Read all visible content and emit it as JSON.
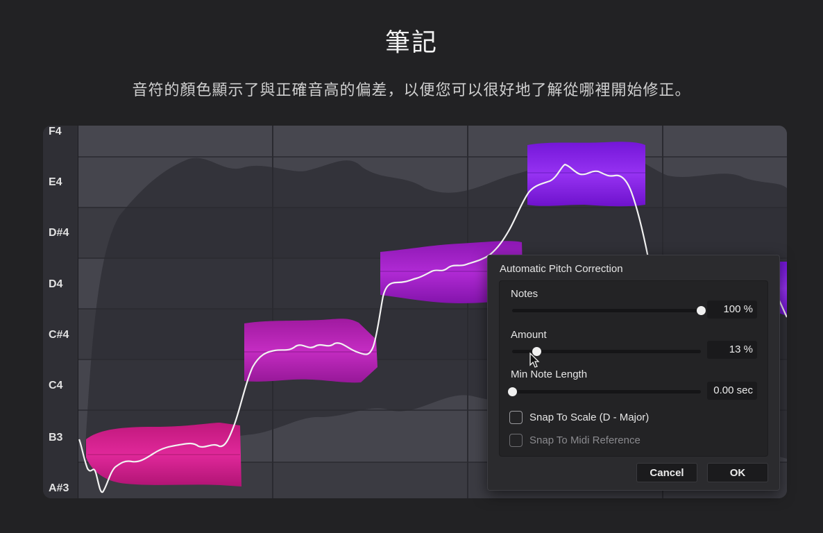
{
  "header": {
    "title": "筆記",
    "subtitle": "音符的顏色顯示了與正確音高的偏差，以便您可以很好地了解從哪裡開始修正。"
  },
  "piano_roll": {
    "keys": [
      "F4",
      "E4",
      "D#4",
      "D4",
      "C#4",
      "C4",
      "B3",
      "A#3"
    ],
    "note_colors": {
      "b3_note": "#d61e8c",
      "c_sharp4_note": "#b824b0",
      "d4_note": "#a61ec4",
      "e4_note": "#8a22e6",
      "d4_second_note": "#7a22e0"
    }
  },
  "dialog": {
    "title": "Automatic Pitch Correction",
    "notes": {
      "label": "Notes",
      "value": "100 %",
      "level": 1.0
    },
    "amount": {
      "label": "Amount",
      "value": "13 %",
      "level": 0.13
    },
    "min_note_length": {
      "label": "Min Note Length",
      "value": "0.00 sec",
      "level": 0.0
    },
    "snap_to_scale": {
      "label": "Snap To Scale (D - Major)",
      "checked": false
    },
    "snap_to_midi": {
      "label": "Snap To Midi Reference",
      "checked": false,
      "enabled": false
    },
    "cancel_label": "Cancel",
    "ok_label": "OK"
  }
}
